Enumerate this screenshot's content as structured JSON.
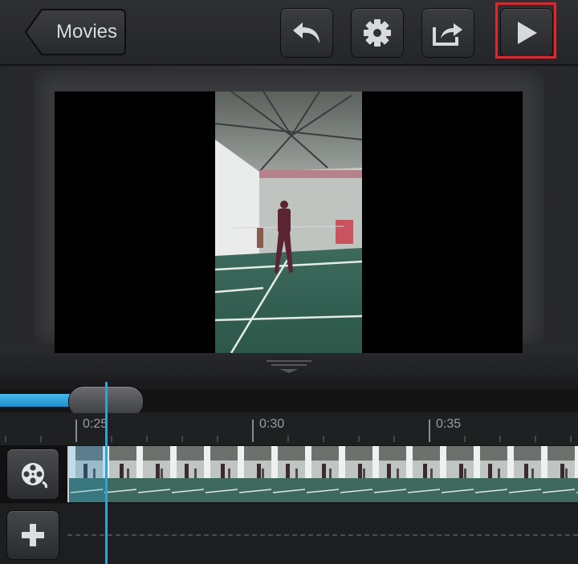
{
  "toolbar": {
    "back_label": "Movies",
    "undo_icon": "undo-icon",
    "settings_icon": "gear-icon",
    "share_icon": "share-icon",
    "play_icon": "play-icon"
  },
  "colors": {
    "accent": "#2aa4e2",
    "highlight": "#e5252a"
  },
  "timeline": {
    "ticks": [
      {
        "label": "0:25"
      },
      {
        "label": "0:30"
      },
      {
        "label": "0:35"
      }
    ]
  },
  "tracks": {
    "video_icon": "film-reel-icon",
    "add_icon": "plus-icon"
  }
}
